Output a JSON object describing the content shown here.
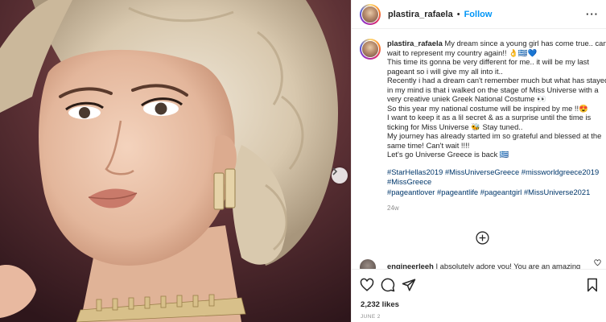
{
  "post": {
    "username": "plastira_rafaela",
    "dot": "•",
    "follow_label": "Follow",
    "more_label": "···"
  },
  "caption": {
    "username": "plastira_rafaela",
    "lines": [
      "My dream since a young girl has come true.. cant",
      "wait to represent my country again!! 👌🇬🇷💙",
      "This time its gonna be very different for me.. it will be my last",
      "pageant so i will give my all into it..",
      "Recently i had a dream can't remember much but what has stayed",
      "in my mind is that i walked on the stage of Miss Universe with a",
      "very creative uniek Greek National Costume 👀",
      "So this year my national costume will be inspired by me !!😍",
      "I want to keep it as a lil secret & as a surprise until the time is",
      "ticking for Miss Universe 🐝 Stay tuned..",
      "My journey has already started im so grateful and blessed at the",
      "same time! Can't wait !!!!",
      "Let's go Universe Greece is back 🇬🇷"
    ],
    "hashtag_lines": [
      [
        "#StarHellas2019",
        "#MissUniverseGreece",
        "#missworldgreece2019"
      ],
      [
        "#MissGreece"
      ],
      [
        "#pageantlover",
        "#pageantlife",
        "#pageantgirl",
        "#MissUniverse2021"
      ]
    ],
    "time_ago": "24w"
  },
  "comment": {
    "username": "engineerleeh",
    "text": "I absolutely adore you! You are an amazing"
  },
  "actions": {
    "likes": "2,232 likes",
    "date": "JUNE 2"
  },
  "icons": {
    "next": "chevron-right-icon",
    "load_more": "plus-circle-icon",
    "like": "heart-icon",
    "comment": "comment-icon",
    "share": "share-icon",
    "save": "bookmark-icon"
  },
  "colors": {
    "link": "#00376b",
    "follow": "#0095f6",
    "muted": "#8e8e8e"
  }
}
